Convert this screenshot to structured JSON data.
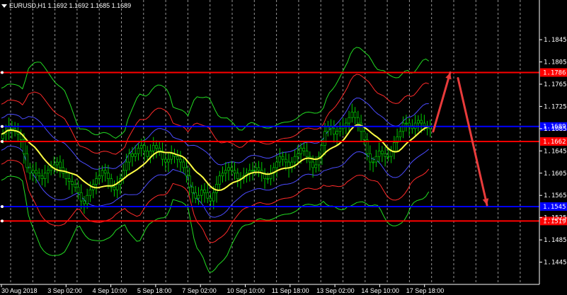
{
  "header": {
    "symbol": "EURUSD,H1",
    "ohlc": "1.1692 1.1692 1.1685 1.1689"
  },
  "chart_data": {
    "type": "candlestick",
    "y_range": [
      1.1405,
      1.191
    ],
    "y_ticks": [
      "1.1845",
      "1.1805",
      "1.1765",
      "1.1725",
      "1.1685",
      "1.1645",
      "1.1605",
      "1.1565",
      "1.1525",
      "1.1485",
      "1.1445"
    ],
    "x_ticks": [
      "30 Aug 2018",
      "3 Sep 02:00",
      "4 Sep 10:00",
      "5 Sep 18:00",
      "7 Sep 02:00",
      "10 Sep 10:00",
      "11 Sep 18:00",
      "13 Sep 02:00",
      "14 Sep 10:00",
      "17 Sep 18:00"
    ],
    "bars_shown": 145,
    "close_series": [
      1.1675,
      1.168,
      1.169,
      1.1685,
      1.168,
      1.1675,
      1.1665,
      1.164,
      1.1615,
      1.1605,
      1.161,
      1.1605,
      1.16,
      1.1595,
      1.1605,
      1.161,
      1.1615,
      1.162,
      1.1625,
      1.1615,
      1.1605,
      1.1595,
      1.159,
      1.1585,
      1.158,
      1.157,
      1.1555,
      1.155,
      1.1565,
      1.1575,
      1.1585,
      1.1595,
      1.16,
      1.161,
      1.1605,
      1.1595,
      1.158,
      1.1575,
      1.1585,
      1.1595,
      1.161,
      1.1625,
      1.164,
      1.1635,
      1.164,
      1.165,
      1.1655,
      1.1645,
      1.1635,
      1.1645,
      1.1655,
      1.165,
      1.1645,
      1.163,
      1.1625,
      1.163,
      1.164,
      1.1635,
      1.163,
      1.1625,
      1.1615,
      1.16,
      1.158,
      1.157,
      1.156,
      1.1565,
      1.1575,
      1.157,
      1.156,
      1.1555,
      1.157,
      1.1585,
      1.16,
      1.1605,
      1.161,
      1.1615,
      1.161,
      1.1605,
      1.1595,
      1.1595,
      1.16,
      1.1605,
      1.161,
      1.161,
      1.1615,
      1.161,
      1.1605,
      1.1595,
      1.1595,
      1.1605,
      1.1615,
      1.1625,
      1.1635,
      1.163,
      1.1625,
      1.1615,
      1.1625,
      1.1635,
      1.164,
      1.165,
      1.1645,
      1.1635,
      1.1625,
      1.1615,
      1.162,
      1.1635,
      1.1655,
      1.168,
      1.169,
      1.1685,
      1.1675,
      1.168,
      1.1685,
      1.169,
      1.1695,
      1.1705,
      1.1715,
      1.1705,
      1.1695,
      1.168,
      1.1665,
      1.164,
      1.1625,
      1.1625,
      1.1635,
      1.1645,
      1.164,
      1.1635,
      1.1635,
      1.1645,
      1.166,
      1.167,
      1.168,
      1.1695,
      1.1695,
      1.169,
      1.1685,
      1.1695,
      1.17,
      1.1695,
      1.169,
      1.1685,
      1.1689
    ],
    "moving_average": {
      "color": "#ffff44",
      "label": ""
    },
    "bands": [
      {
        "color": "#4b4bff",
        "role": "band-1"
      },
      {
        "color": "#ff2a2a",
        "role": "band-2"
      },
      {
        "color": "#22dd22",
        "role": "band-3"
      }
    ],
    "hlines": [
      {
        "price": 1.1786,
        "label": "1.1786",
        "color": "#ff0000"
      },
      {
        "price": 1.1689,
        "label": "1.1689",
        "color": "#0000ff"
      },
      {
        "price": 1.1662,
        "label": "1.1662",
        "color": "#ff0000"
      },
      {
        "price": 1.1545,
        "label": "1.1545",
        "color": "#0000ff"
      },
      {
        "price": 1.1519,
        "label": "1.1519",
        "color": "#ff0000"
      }
    ],
    "current_price_label": "1.1689",
    "colors": {
      "bull": "#00cc00",
      "bear": "#00cc00",
      "grid": "#bbbbbb",
      "axis": "#ffffff",
      "arrow": "#e83b3b"
    }
  }
}
